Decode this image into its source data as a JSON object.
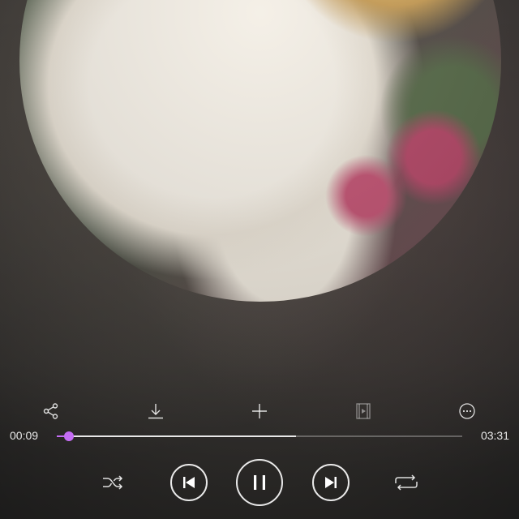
{
  "player": {
    "current_time": "00:09",
    "duration": "03:31",
    "progress_played": 0.029,
    "progress_buffered": 0.59,
    "state": "playing"
  },
  "actions": [
    "share-icon",
    "download-icon",
    "add-icon",
    "mv-video-icon",
    "more-icon"
  ],
  "transport": [
    "shuffle-icon",
    "previous-icon",
    "pause-icon",
    "next-icon",
    "repeat-icon"
  ],
  "colors": {
    "accent": "#c56df5",
    "icon": "#ffffff",
    "background": "#3f3c39"
  }
}
